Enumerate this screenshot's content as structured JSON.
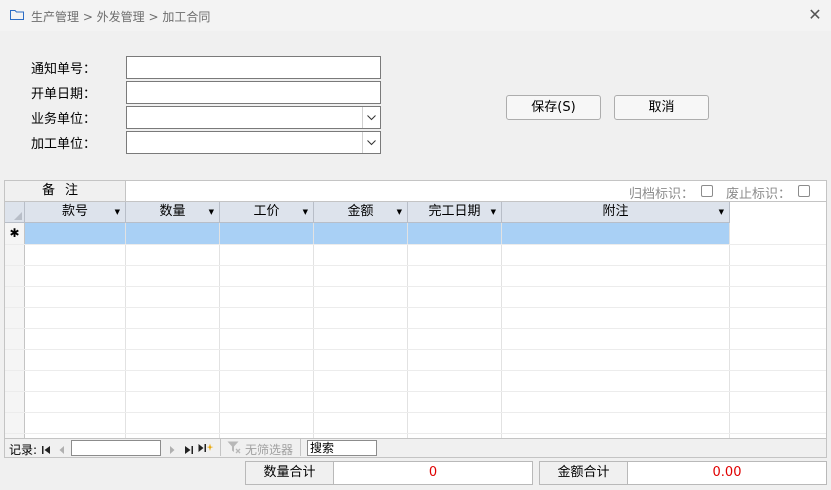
{
  "window": {
    "breadcrumb": "生产管理 > 外发管理 > 加工合同",
    "close_glyph": "✕"
  },
  "form": {
    "notice_no_label": "通知单号：",
    "open_date_label": "开单日期：",
    "business_unit_label": "业务单位：",
    "process_unit_label": "加工单位：",
    "notice_no_value": "",
    "open_date_value": "",
    "business_unit_value": "",
    "process_unit_value": ""
  },
  "buttons": {
    "save": "保存(S)",
    "cancel": "取消"
  },
  "remarks": {
    "label": "备注",
    "value": "",
    "archive_flag_label": "归档标识：",
    "void_flag_label": "废止标识："
  },
  "grid": {
    "columns": [
      "款号",
      "数量",
      "工价",
      "金额",
      "完工日期",
      "附注"
    ],
    "new_row_marker": "✱",
    "selection_color": "#a9d0f5"
  },
  "navigator": {
    "record_label": "记录:",
    "no_filter_label": "无筛选器",
    "search_label": "搜索"
  },
  "totals": {
    "qty_label": "数量合计",
    "qty_value": "0",
    "amount_label": "金额合计",
    "amount_value": "0.00"
  }
}
